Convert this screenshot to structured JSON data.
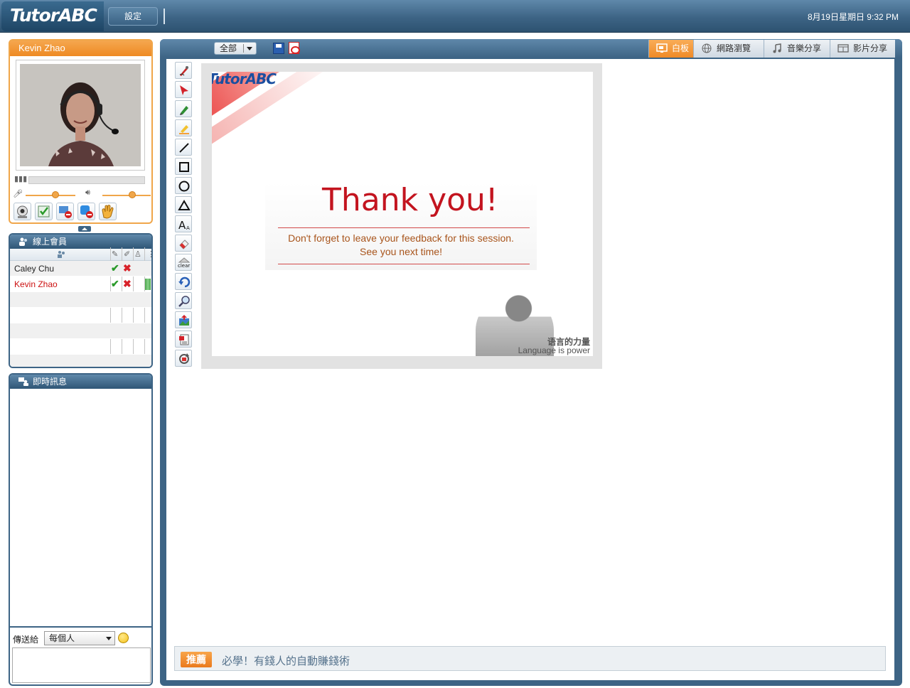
{
  "header": {
    "logo": "TutorABC",
    "settings_label": "設定",
    "datetime": "8月19日星期日 9:32 PM"
  },
  "video": {
    "name": "Kevin Zhao",
    "mic_level": 0.66,
    "speaker_level": 0.62
  },
  "members": {
    "title": "線上會員",
    "rows": [
      {
        "name": "Caley Chu",
        "color": "#000000",
        "status": "✔",
        "status2": "✖"
      },
      {
        "name": "Kevin Zhao",
        "color": "#cc1111",
        "status": "✔",
        "status2": "✖"
      }
    ]
  },
  "chat": {
    "title": "即時訊息",
    "send_to_label": "傳送給",
    "send_to_value": "每個人"
  },
  "main": {
    "filter_label": "全部",
    "tabs": [
      {
        "label": "白板",
        "icon": "whiteboard-icon",
        "active": true
      },
      {
        "label": "網路瀏覽",
        "icon": "globe-icon",
        "active": false
      },
      {
        "label": "音樂分享",
        "icon": "music-icon",
        "active": false
      },
      {
        "label": "影片分享",
        "icon": "video-icon",
        "active": false
      }
    ]
  },
  "slide": {
    "logo": "TutorABC",
    "title": "Thank you!",
    "line1": "Don't forget to leave your feedback for this session.",
    "line2": "See you next time!",
    "slogan_cn": "语言的力量",
    "slogan_en": "Language is power"
  },
  "recommend": {
    "badge": "推薦",
    "text": "必學！有錢人的自動賺錢術"
  },
  "colors": {
    "accent_orange": "#ef8a26",
    "frame_blue": "#3d6485",
    "slide_red": "#c3141f"
  }
}
